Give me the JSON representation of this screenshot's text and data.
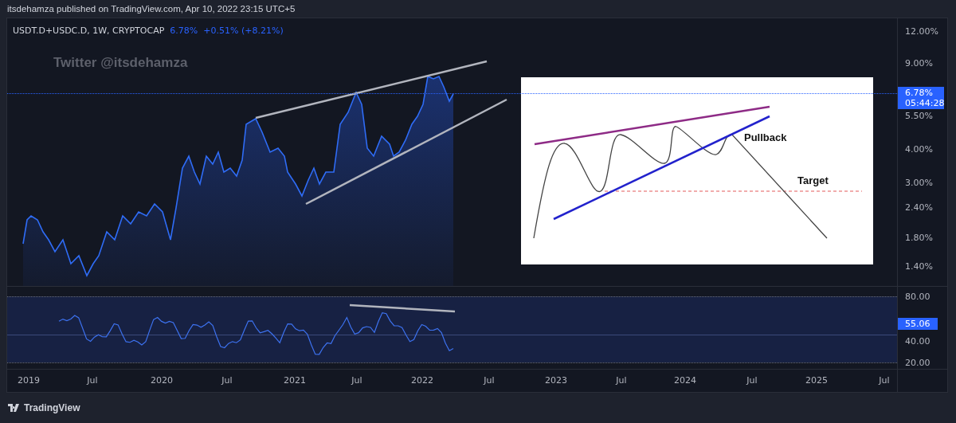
{
  "header": {
    "text": "itsdehamza published on TradingView.com, Apr 10, 2022 23:15 UTC+5"
  },
  "legend": {
    "symbol": "USDT.D+USDC.D, 1W, CRYPTOCAP",
    "value": "6.78%",
    "change": "+0.51% (+8.21%)"
  },
  "annotation": {
    "text": "Twitter @itsdehamza"
  },
  "price_axis": {
    "ticks": [
      "12.00%",
      "9.00%",
      "5.50%",
      "4.00%",
      "3.00%",
      "2.40%",
      "1.80%",
      "1.40%"
    ],
    "last_price": {
      "value": "6.78%",
      "countdown": "05:44:28"
    }
  },
  "inset": {
    "pullback_label": "Pullback",
    "target_label": "Target"
  },
  "rsi_axis": {
    "ticks": [
      "80.00",
      "40.00",
      "20.00"
    ],
    "last_value": "55.06"
  },
  "time_axis": {
    "labels": [
      "2019",
      "Jul",
      "2020",
      "Jul",
      "2021",
      "Jul",
      "2022",
      "Jul",
      "2023",
      "Jul",
      "2024",
      "Jul",
      "2025",
      "Jul"
    ]
  },
  "footer": {
    "brand": "TradingView"
  }
}
